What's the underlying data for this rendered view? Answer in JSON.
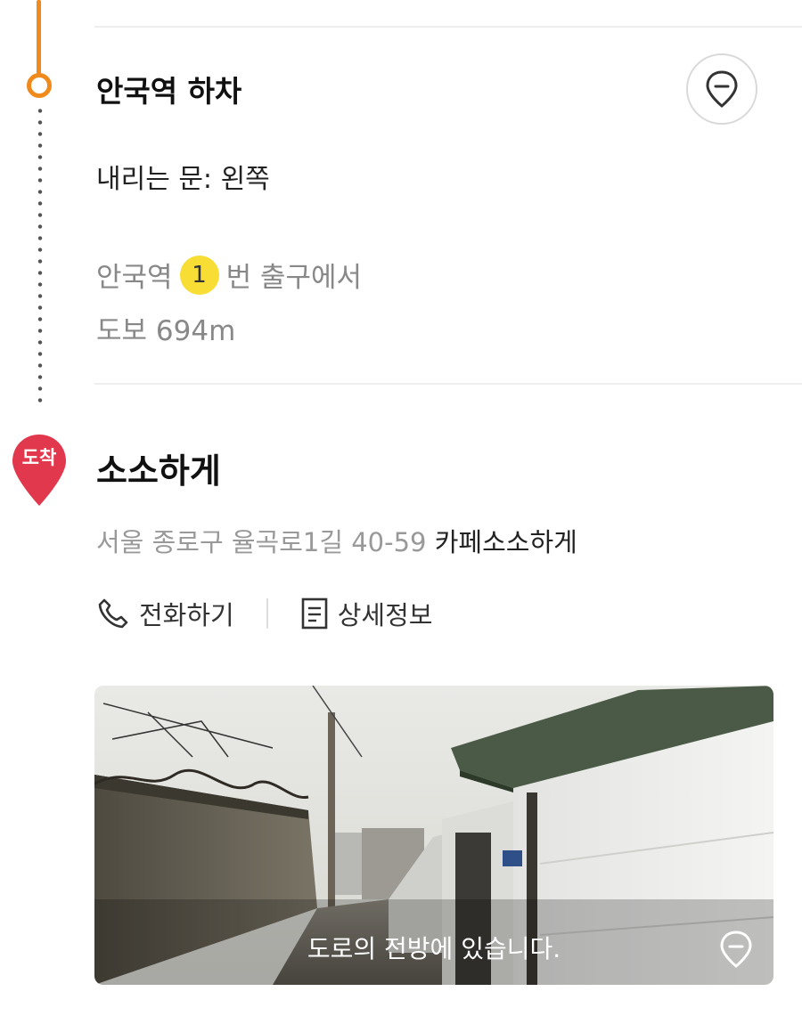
{
  "step_off": {
    "title": "안국역 하차",
    "door_label": "내리는 문: 왼쪽",
    "exit_station": "안국역",
    "exit_number": "1",
    "exit_suffix": "번 출구에서",
    "walk": "도보 694m"
  },
  "arrival": {
    "badge": "도착",
    "place": "소소하게",
    "address": "서울 종로구 율곡로1길 40-59",
    "address_tail": "카페소소하게",
    "call_label": "전화하기",
    "detail_label": "상세정보"
  },
  "streetview": {
    "caption": "도로의 전방에 있습니다."
  },
  "colors": {
    "route_orange": "#f08a1c",
    "arrival_red": "#e2384d",
    "exit_yellow": "#f7dd34"
  },
  "icons": [
    "location-pin-icon",
    "phone-icon",
    "document-icon",
    "arrival-marker-icon"
  ]
}
